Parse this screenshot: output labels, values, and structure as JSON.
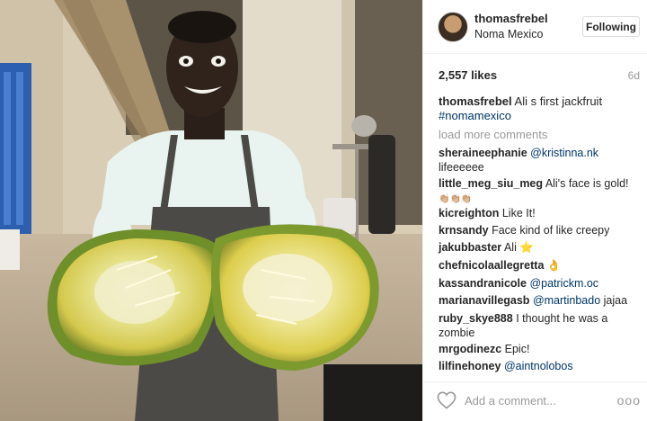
{
  "post": {
    "username": "thomasfrebel",
    "location": "Noma Mexico",
    "follow_label": "Following",
    "likes": "2,557 likes",
    "age": "6d",
    "caption": {
      "user": "thomasfrebel",
      "text": "Ali s first jackfruit",
      "hashtag": "#nomamexico"
    },
    "load_more": "load more comments"
  },
  "comments": [
    {
      "user": "sheraineephanie",
      "mention": "@kristinna.nk",
      "text": "lifeeeeee"
    },
    {
      "user": "little_meg_siu_meg",
      "text": "Ali's face is gold!",
      "extra": "👏🏼👏🏼👏🏼"
    },
    {
      "user": "kicreighton",
      "text": "Like It!"
    },
    {
      "user": "krnsandy",
      "text": "Face kind of like creepy"
    },
    {
      "user": "jakubbaster",
      "text": "Ali ⭐"
    },
    {
      "user": "chefnicolaallegretta",
      "text": "👌"
    },
    {
      "user": "kassandranicole",
      "mention": "@patrickm.oc"
    },
    {
      "user": "marianavillegasb",
      "mention": "@martinbado",
      "text": "jajaa"
    },
    {
      "user": "ruby_skye888",
      "text": "I thought he was a zombie"
    },
    {
      "user": "mrgodinezc",
      "text": "Epic!"
    },
    {
      "user": "lilfinehoney",
      "mention": "@aintnolobos"
    }
  ],
  "footer": {
    "placeholder": "Add a comment...",
    "more": "ooo"
  },
  "icons": {
    "like": "heart-outline-icon",
    "more": "more-options-icon"
  },
  "colors": {
    "link": "#003569",
    "muted": "#999999",
    "text": "#262626"
  }
}
